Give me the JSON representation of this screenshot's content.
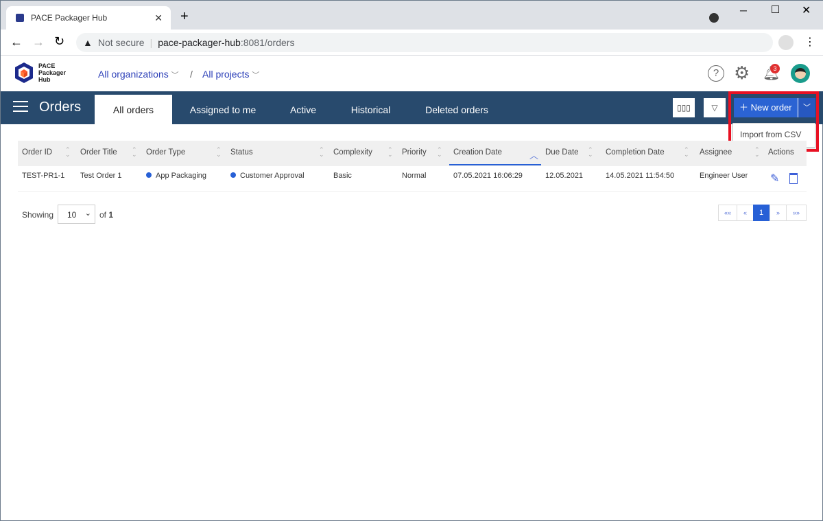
{
  "browser": {
    "tab_title": "PACE Packager Hub",
    "security": "Not secure",
    "url_host": "pace-packager-hub",
    "url_rest": ":8081/orders"
  },
  "header": {
    "logo_text": "PACE Packager Hub",
    "organization": "All organizations",
    "separator": "/",
    "project": "All projects",
    "notification_count": "3"
  },
  "nav": {
    "title": "Orders",
    "tabs": [
      {
        "label": "All orders",
        "active": true
      },
      {
        "label": "Assigned to me"
      },
      {
        "label": "Active"
      },
      {
        "label": "Historical"
      },
      {
        "label": "Deleted orders"
      }
    ],
    "new_order": "New order",
    "dropdown": {
      "items": [
        "Import from CSV"
      ]
    }
  },
  "table": {
    "columns": [
      "Order ID",
      "Order Title",
      "Order Type",
      "Status",
      "Complexity",
      "Priority",
      "Creation Date",
      "Due Date",
      "Completion Date",
      "Assignee",
      "Actions"
    ],
    "sorted_column": "Creation Date",
    "sort_direction": "ascending",
    "rows": [
      {
        "order_id": "TEST-PR1-1",
        "title": "Test Order 1",
        "type": "App Packaging",
        "status": "Customer Approval",
        "complexity": "Basic",
        "priority": "Normal",
        "creation_date": "07.05.2021 16:06:29",
        "due_date": "12.05.2021",
        "completion_date": "14.05.2021 11:54:50",
        "assignee": "Engineer User"
      }
    ]
  },
  "footer": {
    "showing": "Showing",
    "page_size": "10",
    "of": "of",
    "total_pages": "1",
    "pagination": [
      "««",
      "«",
      "1",
      "»",
      "»»"
    ],
    "current_page": "1"
  },
  "colors": {
    "nav": "#284a6d",
    "accent": "#2760d6",
    "highlight": "#e81123"
  }
}
